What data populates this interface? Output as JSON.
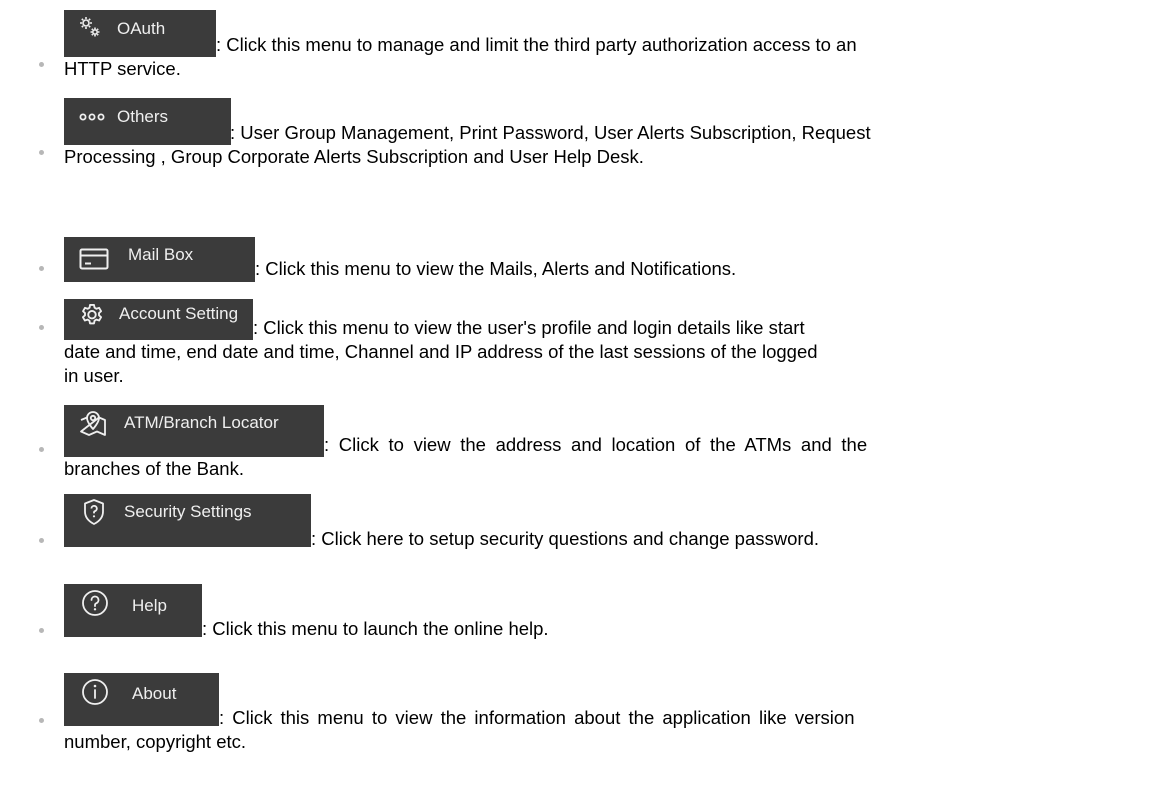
{
  "items": [
    {
      "button": "OAuth",
      "icon": "gears-icon",
      "desc_lines": [
        ": Click this menu to manage and limit the third party authorization access to an",
        "HTTP service."
      ]
    },
    {
      "button": "Others",
      "icon": "more-dots-icon",
      "desc_lines": [
        ": User Group Management, Print Password, User Alerts Subscription, Request",
        "Processing , Group Corporate Alerts Subscription and User Help Desk."
      ]
    },
    {
      "button": "Mail Box",
      "icon": "mail-card-icon",
      "desc_lines": [
        ": Click this menu to view the Mails, Alerts and Notifications."
      ]
    },
    {
      "button": "Account Setting",
      "icon": "gear-icon",
      "desc_lines": [
        ": Click this menu to view the user's profile and   login details like start",
        "date and time, end date and time, Channel and IP address of the last sessions of the  logged",
        "in user."
      ]
    },
    {
      "button": "ATM/Branch Locator",
      "icon": "map-pin-icon",
      "desc_lines": [
        ": Click to view the address and location of the ATMs and the",
        "branches of the Bank."
      ]
    },
    {
      "button": "Security Settings",
      "icon": "shield-question-icon",
      "desc_lines": [
        ": Click here to setup security questions and change password."
      ]
    },
    {
      "button": "Help",
      "icon": "help-circle-icon",
      "desc_lines": [
        ": Click this menu to launch the online help."
      ]
    },
    {
      "button": "About",
      "icon": "info-circle-icon",
      "desc_lines": [
        ": Click this menu to view the information about the application like version",
        "number, copyright etc."
      ]
    }
  ]
}
